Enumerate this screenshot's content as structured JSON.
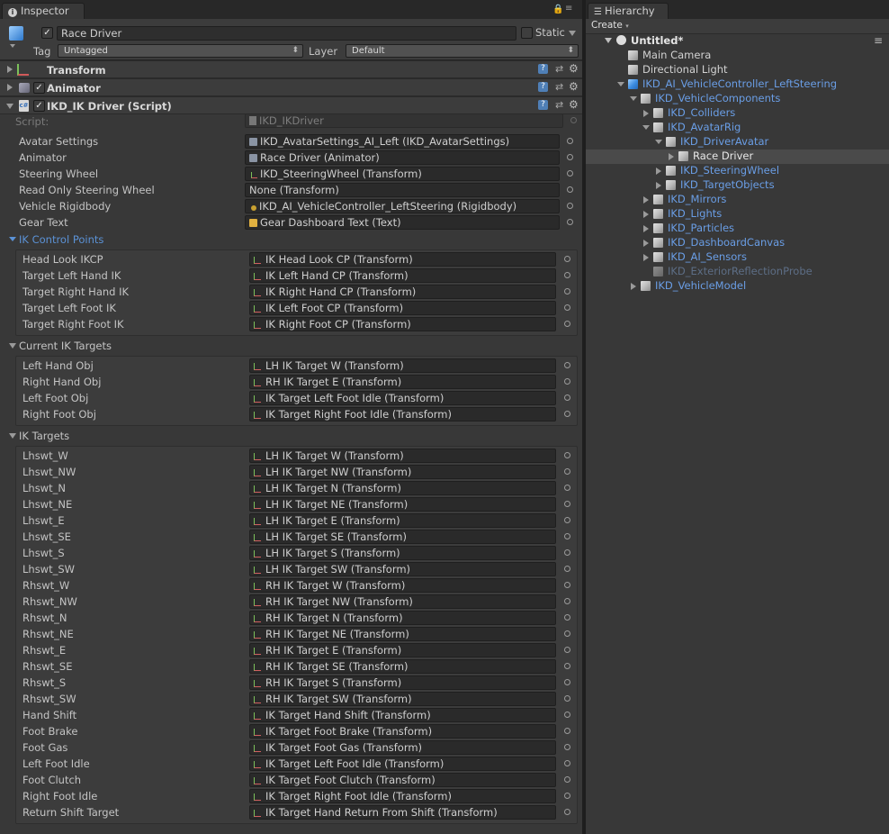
{
  "inspector": {
    "tab_label": "Inspector",
    "object": {
      "name": "Race Driver",
      "static_label": "Static",
      "tag_label": "Tag",
      "tag_value": "Untagged",
      "layer_label": "Layer",
      "layer_value": "Default"
    },
    "components": {
      "transform": "Transform",
      "animator": "Animator",
      "script": "IKD_IK Driver (Script)"
    },
    "script_label": "Script:",
    "script_value": "IKD_IKDriver",
    "main_fields": [
      {
        "label": "Avatar Settings",
        "value": "IKD_AvatarSettings_AI_Left (IKD_AvatarSettings)",
        "icon": "asset-icon"
      },
      {
        "label": "Animator",
        "value": "Race Driver (Animator)",
        "icon": "animator-icon"
      },
      {
        "label": "Steering Wheel",
        "value": "IKD_SteeringWheel (Transform)",
        "icon": "transform-icon"
      },
      {
        "label": "Read Only Steering Wheel",
        "value": "None (Transform)",
        "icon": ""
      },
      {
        "label": "Vehicle Rigidbody",
        "value": "IKD_AI_VehicleController_LeftSteering (Rigidbody)",
        "icon": "rigidbody-icon"
      },
      {
        "label": "Gear Text",
        "value": "Gear Dashboard Text (Text)",
        "icon": "text-icon"
      }
    ],
    "sections": [
      {
        "title": "IK Control Points",
        "fields": [
          {
            "label": "Head Look IKCP",
            "value": "IK Head Look CP (Transform)"
          },
          {
            "label": "Target Left Hand IK",
            "value": "IK Left Hand CP (Transform)"
          },
          {
            "label": "Target Right Hand IK",
            "value": "IK Right Hand CP (Transform)"
          },
          {
            "label": "Target Left Foot IK",
            "value": "IK Left Foot CP (Transform)"
          },
          {
            "label": "Target Right Foot IK",
            "value": "IK Right Foot CP (Transform)"
          }
        ]
      },
      {
        "title": "Current IK Targets",
        "fields": [
          {
            "label": "Left Hand Obj",
            "value": "LH IK Target W (Transform)"
          },
          {
            "label": "Right Hand Obj",
            "value": "RH IK Target E (Transform)"
          },
          {
            "label": "Left Foot Obj",
            "value": "IK Target Left Foot Idle (Transform)"
          },
          {
            "label": "Right Foot Obj",
            "value": "IK Target Right Foot Idle (Transform)"
          }
        ]
      },
      {
        "title": "IK Targets",
        "fields": [
          {
            "label": "Lhswt_W",
            "value": "LH IK Target W (Transform)"
          },
          {
            "label": "Lhswt_NW",
            "value": "LH IK Target NW (Transform)"
          },
          {
            "label": "Lhswt_N",
            "value": "LH IK Target N (Transform)"
          },
          {
            "label": "Lhswt_NE",
            "value": "LH IK Target NE (Transform)"
          },
          {
            "label": "Lhswt_E",
            "value": "LH IK Target E (Transform)"
          },
          {
            "label": "Lhswt_SE",
            "value": "LH IK Target SE (Transform)"
          },
          {
            "label": "Lhswt_S",
            "value": "LH IK Target S (Transform)"
          },
          {
            "label": "Lhswt_SW",
            "value": "LH IK Target SW (Transform)"
          },
          {
            "label": "Rhswt_W",
            "value": "RH IK Target W (Transform)"
          },
          {
            "label": "Rhswt_NW",
            "value": "RH IK Target NW (Transform)"
          },
          {
            "label": "Rhswt_N",
            "value": "RH IK Target N (Transform)"
          },
          {
            "label": "Rhswt_NE",
            "value": "RH IK Target NE (Transform)"
          },
          {
            "label": "Rhswt_E",
            "value": "RH IK Target E (Transform)"
          },
          {
            "label": "Rhswt_SE",
            "value": "RH IK Target SE (Transform)"
          },
          {
            "label": "Rhswt_S",
            "value": "RH IK Target S (Transform)"
          },
          {
            "label": "Rhswt_SW",
            "value": "RH IK Target SW (Transform)"
          },
          {
            "label": "Hand Shift",
            "value": "IK Target Hand Shift (Transform)"
          },
          {
            "label": "Foot Brake",
            "value": "IK Target Foot Brake (Transform)"
          },
          {
            "label": "Foot Gas",
            "value": "IK Target Foot Gas (Transform)"
          },
          {
            "label": "Left Foot Idle",
            "value": "IK Target Left Foot Idle (Transform)"
          },
          {
            "label": "Foot Clutch",
            "value": "IK Target Foot Clutch (Transform)"
          },
          {
            "label": "Right Foot Idle",
            "value": "IK Target Right Foot Idle (Transform)"
          },
          {
            "label": "Return Shift Target",
            "value": "IK Target Hand Return From Shift (Transform)"
          }
        ]
      }
    ]
  },
  "hierarchy": {
    "tab_label": "Hierarchy",
    "create_label": "Create",
    "scene": "Untitled*",
    "items": [
      {
        "name": "Main Camera",
        "depth": 1,
        "expander": "none",
        "prefab": false,
        "selected": false,
        "disabled": false,
        "root": false
      },
      {
        "name": "Directional Light",
        "depth": 1,
        "expander": "none",
        "prefab": false,
        "selected": false,
        "disabled": false,
        "root": false
      },
      {
        "name": "IKD_AI_VehicleController_LeftSteering",
        "depth": 1,
        "expander": "open",
        "prefab": true,
        "selected": false,
        "disabled": false,
        "root": true
      },
      {
        "name": "IKD_VehicleComponents",
        "depth": 2,
        "expander": "open",
        "prefab": true,
        "selected": false,
        "disabled": false,
        "root": false
      },
      {
        "name": "IKD_Colliders",
        "depth": 3,
        "expander": "closed",
        "prefab": true,
        "selected": false,
        "disabled": false,
        "root": false
      },
      {
        "name": "IKD_AvatarRig",
        "depth": 3,
        "expander": "open",
        "prefab": true,
        "selected": false,
        "disabled": false,
        "root": false
      },
      {
        "name": "IKD_DriverAvatar",
        "depth": 4,
        "expander": "open",
        "prefab": true,
        "selected": false,
        "disabled": false,
        "root": false
      },
      {
        "name": "Race Driver",
        "depth": 5,
        "expander": "closed",
        "prefab": false,
        "selected": true,
        "disabled": false,
        "root": false
      },
      {
        "name": "IKD_SteeringWheel",
        "depth": 4,
        "expander": "closed",
        "prefab": true,
        "selected": false,
        "disabled": false,
        "root": false
      },
      {
        "name": "IKD_TargetObjects",
        "depth": 4,
        "expander": "closed",
        "prefab": true,
        "selected": false,
        "disabled": false,
        "root": false
      },
      {
        "name": "IKD_Mirrors",
        "depth": 3,
        "expander": "closed",
        "prefab": true,
        "selected": false,
        "disabled": false,
        "root": false
      },
      {
        "name": "IKD_Lights",
        "depth": 3,
        "expander": "closed",
        "prefab": true,
        "selected": false,
        "disabled": false,
        "root": false
      },
      {
        "name": "IKD_Particles",
        "depth": 3,
        "expander": "closed",
        "prefab": true,
        "selected": false,
        "disabled": false,
        "root": false
      },
      {
        "name": "IKD_DashboardCanvas",
        "depth": 3,
        "expander": "closed",
        "prefab": true,
        "selected": false,
        "disabled": false,
        "root": false
      },
      {
        "name": "IKD_AI_Sensors",
        "depth": 3,
        "expander": "closed",
        "prefab": true,
        "selected": false,
        "disabled": false,
        "root": false
      },
      {
        "name": "IKD_ExteriorReflectionProbe",
        "depth": 3,
        "expander": "none",
        "prefab": true,
        "selected": false,
        "disabled": true,
        "root": false
      },
      {
        "name": "IKD_VehicleModel",
        "depth": 2,
        "expander": "closed",
        "prefab": true,
        "selected": false,
        "disabled": false,
        "root": false
      }
    ]
  },
  "colors": {
    "panel": "#383838",
    "prefab_text": "#6a9ee6",
    "prefab_disabled": "#5d6e86",
    "selection": "#4a4a4a",
    "section_blue": "#5b92d6"
  }
}
